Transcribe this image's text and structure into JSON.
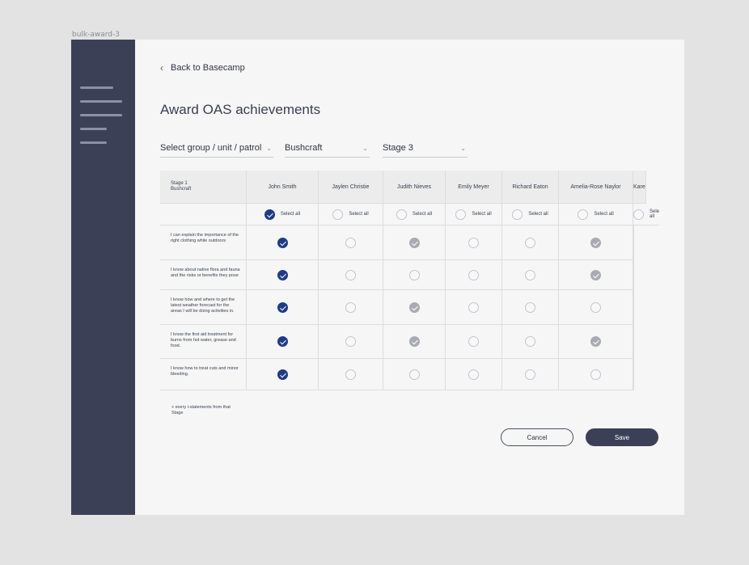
{
  "frame_label": "bulk-award-3",
  "nav": {
    "back_label": "Back to Basecamp"
  },
  "page": {
    "title": "Award OAS achievements"
  },
  "filters": [
    {
      "value": "Select group / unit / patrol"
    },
    {
      "value": "Bushcraft"
    },
    {
      "value": "Stage 3"
    }
  ],
  "table": {
    "corner": {
      "line1": "Stage 1",
      "line2": "Bushcraft"
    },
    "select_all_label": "Select all",
    "people": [
      {
        "name": "John Smith",
        "select_all": "checked"
      },
      {
        "name": "Jaylen Christie",
        "select_all": "empty"
      },
      {
        "name": "Judith Nieves",
        "select_all": "empty"
      },
      {
        "name": "Emily Meyer",
        "select_all": "empty"
      },
      {
        "name": "Richard Eaton",
        "select_all": "empty"
      },
      {
        "name": "Amelia-Rose Naylor",
        "select_all": "empty"
      },
      {
        "name": "Kare",
        "select_all": "empty"
      }
    ],
    "statements": [
      {
        "text": "I can explain the importance of the right clothing while outdoors",
        "states": [
          "checked",
          "empty",
          "achieved",
          "empty",
          "empty",
          "achieved",
          "none"
        ]
      },
      {
        "text": "I know about native flora and fauna and the risks or benefits they pose",
        "states": [
          "checked",
          "empty",
          "empty",
          "empty",
          "empty",
          "achieved",
          "none"
        ]
      },
      {
        "text": "I know how and where to get the latest weather forecast for the areas I will be doing activities in.",
        "states": [
          "checked",
          "empty",
          "achieved",
          "empty",
          "empty",
          "empty",
          "none"
        ]
      },
      {
        "text": "I know the first aid treatment for burns from hot water, grease and food.",
        "states": [
          "checked",
          "empty",
          "achieved",
          "empty",
          "empty",
          "achieved",
          "none"
        ]
      },
      {
        "text": "I know how to treat cuts and minor bleeding.",
        "states": [
          "checked",
          "empty",
          "empty",
          "empty",
          "empty",
          "empty",
          "none"
        ]
      }
    ]
  },
  "footnote": "+ every i-statements from that Stage",
  "actions": {
    "cancel_label": "Cancel",
    "save_label": "Save"
  },
  "colors": {
    "sidebar": "#3c4057",
    "checked": "#1f3c86",
    "achieved": "#a8abb4",
    "background": "#f6f6f6"
  },
  "icons": {
    "back": "chevron-left-icon",
    "menu": "hamburger-menu-icon",
    "dropdown": "chevron-down-icon",
    "check": "checkmark-icon"
  }
}
